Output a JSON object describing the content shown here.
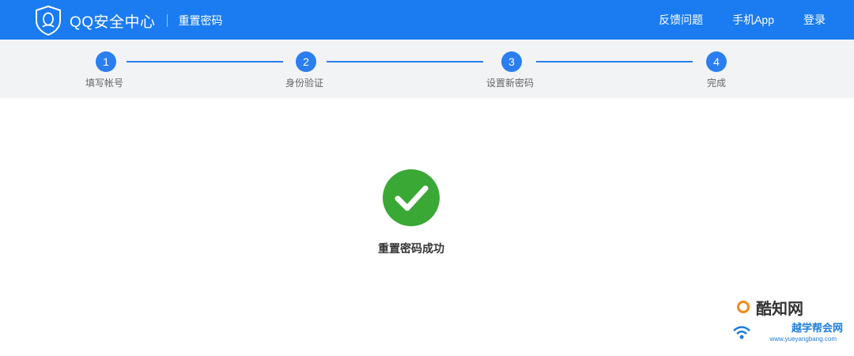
{
  "header": {
    "brand": "QQ安全中心",
    "subtitle": "重置密码",
    "nav": [
      "反馈问题",
      "手机App",
      "登录"
    ]
  },
  "steps": [
    {
      "number": "1",
      "label": "填写帐号"
    },
    {
      "number": "2",
      "label": "身份验证"
    },
    {
      "number": "3",
      "label": "设置新密码"
    },
    {
      "number": "4",
      "label": "完成"
    }
  ],
  "result": {
    "message": "重置密码成功"
  },
  "watermark": {
    "line1": "酷知网",
    "line2": "越学帮会网",
    "line3": "www.yueyangbang.com"
  },
  "colors": {
    "header_bg": "#1a7cf0",
    "step_active": "#2a7ef0",
    "success_green": "#3aa835"
  }
}
